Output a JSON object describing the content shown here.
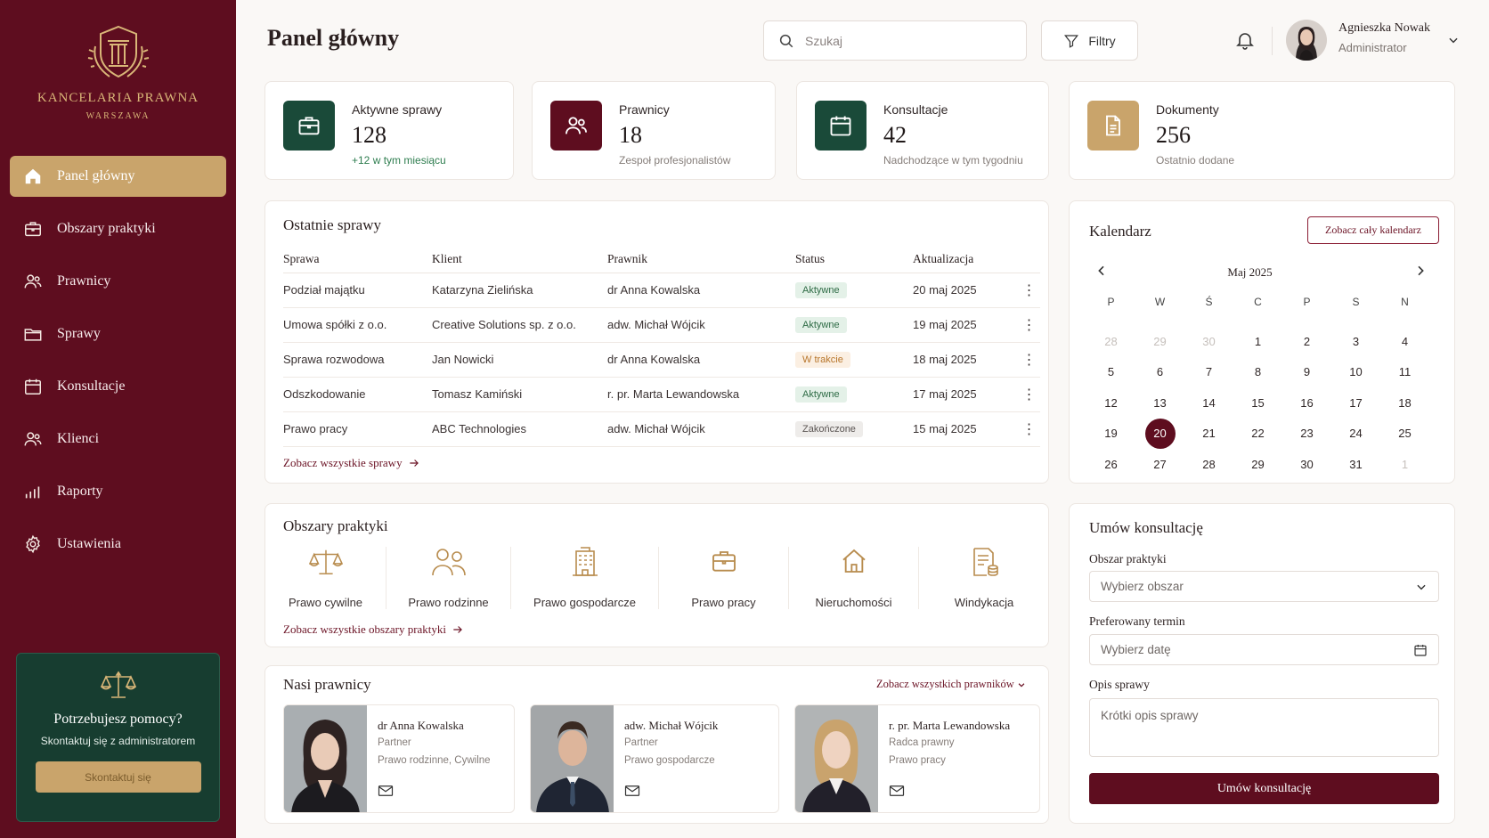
{
  "brand": {
    "name": "KANCELARIA PRAWNA",
    "city": "WARSZAWA"
  },
  "sidebar": {
    "items": [
      {
        "label": "Panel główny",
        "icon": "home-icon",
        "active": true
      },
      {
        "label": "Obszary praktyki",
        "icon": "briefcase-icon"
      },
      {
        "label": "Prawnicy",
        "icon": "users-icon"
      },
      {
        "label": "Sprawy",
        "icon": "folder-icon"
      },
      {
        "label": "Konsultacje",
        "icon": "calendar-icon"
      },
      {
        "label": "Klienci",
        "icon": "clients-icon"
      },
      {
        "label": "Raporty",
        "icon": "bar-chart-icon"
      },
      {
        "label": "Ustawienia",
        "icon": "gear-icon"
      }
    ],
    "help": {
      "title": "Potrzebujesz pomocy?",
      "text": "Skontaktuj się z administratorem",
      "button": "Skontaktuj się"
    }
  },
  "header": {
    "title": "Panel główny",
    "search_placeholder": "Szukaj",
    "filters_label": "Filtry",
    "user": {
      "name": "Agnieszka Nowak",
      "role": "Administrator"
    }
  },
  "stats": [
    {
      "label": "Aktywne sprawy",
      "value": "128",
      "sub": "+12 w tym miesiącu",
      "color": "#1a4a39"
    },
    {
      "label": "Prawnicy",
      "value": "18",
      "sub": "Zespoł profesjonalistów",
      "color": "#5e0d1f"
    },
    {
      "label": "Konsultacje",
      "value": "42",
      "sub": "Nadchodzące w tym tygodniu",
      "color": "#1a4a39"
    },
    {
      "label": "Dokumenty",
      "value": "256",
      "sub": "Ostatnio dodane",
      "color": "#c9a46b"
    }
  ],
  "cases": {
    "title": "Ostatnie sprawy",
    "columns": [
      "Sprawa",
      "Klient",
      "Prawnik",
      "Status",
      "Aktualizacja"
    ],
    "rows": [
      [
        "Podział majątku",
        "Katarzyna Zielińska",
        "dr Anna Kowalska",
        "Aktywne",
        "20 maj 2025"
      ],
      [
        "Umowa spółki z o.o.",
        "Creative Solutions sp. z o.o.",
        "adw. Michał Wójcik",
        "Aktywne",
        "19 maj 2025"
      ],
      [
        "Sprawa rozwodowa",
        "Jan Nowicki",
        "dr Anna Kowalska",
        "W trakcie",
        "18 maj 2025"
      ],
      [
        "Odszkodowanie",
        "Tomasz Kamiński",
        "r. pr. Marta Lewandowska",
        "Aktywne",
        "17 maj 2025"
      ],
      [
        "Prawo pracy",
        "ABC Technologies",
        "adw. Michał Wójcik",
        "Zakończone",
        "15 maj 2025"
      ]
    ],
    "link": "Zobacz wszystkie sprawy"
  },
  "areas": {
    "title": "Obszary praktyki",
    "items": [
      {
        "label": "Prawo cywilne",
        "icon": "scales-icon"
      },
      {
        "label": "Prawo rodzinne",
        "icon": "family-icon"
      },
      {
        "label": "Prawo gospodarcze",
        "icon": "building-icon"
      },
      {
        "label": "Prawo pracy",
        "icon": "briefcase-icon"
      },
      {
        "label": "Nieruchomości",
        "icon": "house-icon"
      },
      {
        "label": "Windykacja",
        "icon": "debt-document-icon"
      }
    ],
    "link": "Zobacz wszystkie obszary praktyki"
  },
  "lawyers": {
    "title": "Nasi prawnicy",
    "link": "Zobacz wszystkich prawników",
    "items": [
      {
        "name": "dr Anna Kowalska",
        "role": "Partner",
        "spec": "Prawo rodzinne, Cywilne"
      },
      {
        "name": "adw. Michał Wójcik",
        "role": "Partner",
        "spec": "Prawo gospodarcze"
      },
      {
        "name": "r. pr. Marta Lewandowska",
        "role": "Radca prawny",
        "spec": "Prawo pracy"
      }
    ]
  },
  "calendar": {
    "title": "Kalendarz",
    "button": "Zobacz cały kalendarz",
    "month": "Maj 2025",
    "weekdays": [
      "P",
      "W",
      "Ś",
      "C",
      "P",
      "S",
      "N"
    ],
    "days": [
      "28",
      "29",
      "30",
      "1",
      "2",
      "3",
      "4",
      "5",
      "6",
      "7",
      "8",
      "9",
      "10",
      "11",
      "12",
      "13",
      "14",
      "15",
      "16",
      "17",
      "18",
      "19",
      "20",
      "21",
      "22",
      "23",
      "24",
      "25",
      "26",
      "27",
      "28",
      "29",
      "30",
      "31",
      "1"
    ],
    "muted": [
      0,
      1,
      2,
      34
    ],
    "selected": 22
  },
  "booking": {
    "title": "Umów konsultację",
    "area_label": "Obszar praktyki",
    "area_value": "Wybierz obszar",
    "date_label": "Preferowany termin",
    "date_placeholder": "Wybierz datę",
    "desc_label": "Opis sprawy",
    "desc_placeholder": "Krótki opis sprawy",
    "submit": "Umów konsultację"
  }
}
